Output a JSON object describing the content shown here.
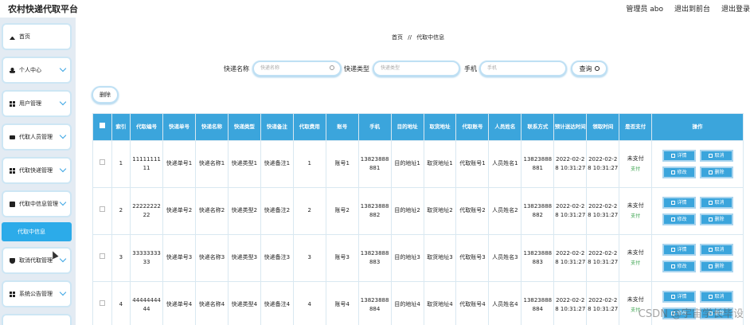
{
  "app": {
    "title": "农村快递代取平台"
  },
  "header": {
    "user_label": "管理员 abo",
    "back_label": "退出到前台",
    "logout_label": "退出登录"
  },
  "sidebar": {
    "items": [
      {
        "label": "首页",
        "icon": "home-icon"
      },
      {
        "label": "个人中心",
        "icon": "user-icon"
      },
      {
        "label": "用户管理",
        "icon": "grid-icon"
      },
      {
        "label": "代取人员管理",
        "icon": "monitor-icon"
      },
      {
        "label": "代取快递管理",
        "icon": "grid-icon"
      },
      {
        "label": "代取中信息管理",
        "icon": "check-icon"
      },
      {
        "label": "取消代取管理",
        "icon": "shield-icon"
      },
      {
        "label": "系统公告管理",
        "icon": "grid-icon"
      }
    ],
    "active_sub": "代取中信息"
  },
  "breadcrumb": {
    "home": "首页",
    "sep": "//",
    "current": "代取中信息"
  },
  "search": {
    "courier_name_label": "快递名称",
    "courier_name_placeholder": "快递名称",
    "courier_type_label": "快递类型",
    "courier_type_placeholder": "快递类型",
    "phone_label": "手机",
    "phone_placeholder": "手机",
    "search_button": "查询"
  },
  "toolbar": {
    "delete_label": "删除"
  },
  "table": {
    "headers": [
      "索引",
      "代取编号",
      "快递单号",
      "快递名称",
      "快递类型",
      "快递备注",
      "代取费用",
      "账号",
      "手机",
      "目的地址",
      "取货地址",
      "代取账号",
      "人员姓名",
      "联系方式",
      "预计送达时间",
      "领取时间",
      "是否支付",
      "操作"
    ],
    "rows": [
      [
        "1",
        "1111111111",
        "快递单号1",
        "快递名称1",
        "快递类型1",
        "快递备注1",
        "1",
        "账号1",
        "13823888881",
        "目的地址1",
        "取货地址1",
        "代取账号1",
        "人员姓名1",
        "13823888881",
        "2022-02-28 10:31:27",
        "2022-02-28 10:31:27",
        "未支付"
      ],
      [
        "2",
        "2222222222",
        "快递单号2",
        "快递名称2",
        "快递类型2",
        "快递备注2",
        "2",
        "账号2",
        "13823888882",
        "目的地址2",
        "取货地址2",
        "代取账号2",
        "人员姓名2",
        "13823888882",
        "2022-02-28 10:31:27",
        "2022-02-28 10:31:27",
        "未支付"
      ],
      [
        "3",
        "3333333333",
        "快递单号3",
        "快递名称3",
        "快递类型3",
        "快递备注3",
        "3",
        "账号3",
        "13823888883",
        "目的地址3",
        "取货地址3",
        "代取账号3",
        "人员姓名3",
        "13823888883",
        "2022-02-28 10:31:27",
        "2022-02-28 10:31:27",
        "未支付"
      ],
      [
        "4",
        "4444444444",
        "快递单号4",
        "快递名称4",
        "快递类型4",
        "快递备注4",
        "4",
        "账号4",
        "13823888884",
        "目的地址4",
        "取货地址4",
        "代取账号4",
        "人员姓名4",
        "13823888884",
        "2022-02-28 10:31:27",
        "2022-02-28 10:31:27",
        "未支付"
      ]
    ],
    "pay_link": "支付",
    "op_labels": {
      "detail": "详情",
      "cancel": "取消",
      "edit": "修改",
      "delete": "删除"
    }
  },
  "watermark": "CSDN @宇宙学长毕设",
  "colors": {
    "accent": "#3ba5dc",
    "paid_link": "#36a14a"
  }
}
